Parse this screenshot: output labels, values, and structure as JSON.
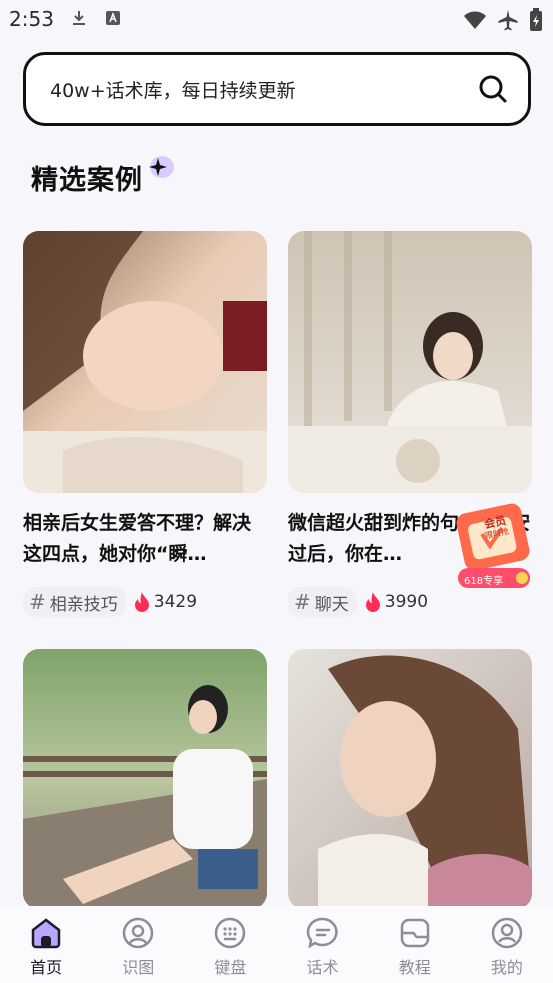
{
  "status_bar": {
    "time": "2:53"
  },
  "search": {
    "placeholder": "40w+话术库，每日持续更新"
  },
  "section": {
    "title": "精选案例"
  },
  "cards": [
    {
      "title": "相亲后女生爱答不理？解决这四点，她对你“瞬…",
      "tag": "相亲技巧",
      "likes": "3429"
    },
    {
      "title": "微信超火甜到炸的句子: 晚安过后，你在…",
      "tag": "聊天",
      "likes": "3990"
    },
    {
      "title": "",
      "tag": "",
      "likes": ""
    },
    {
      "title": "",
      "tag": "",
      "likes": ""
    }
  ],
  "promo": {
    "line1": "会员",
    "line2": "限时抢",
    "line3": "618专享"
  },
  "nav": [
    {
      "label": "首页",
      "icon": "home-icon",
      "active": true
    },
    {
      "label": "识图",
      "icon": "image-recognize-icon",
      "active": false
    },
    {
      "label": "键盘",
      "icon": "keyboard-icon",
      "active": false
    },
    {
      "label": "话术",
      "icon": "chat-bubble-icon",
      "active": false
    },
    {
      "label": "教程",
      "icon": "tutorial-icon",
      "active": false
    },
    {
      "label": "我的",
      "icon": "profile-icon",
      "active": false
    }
  ],
  "colors": {
    "accent": "#ff2d55",
    "nav_active": "#1c1c28",
    "nav_inactive": "#8d8d99",
    "highlight": "#c9b8ff"
  }
}
